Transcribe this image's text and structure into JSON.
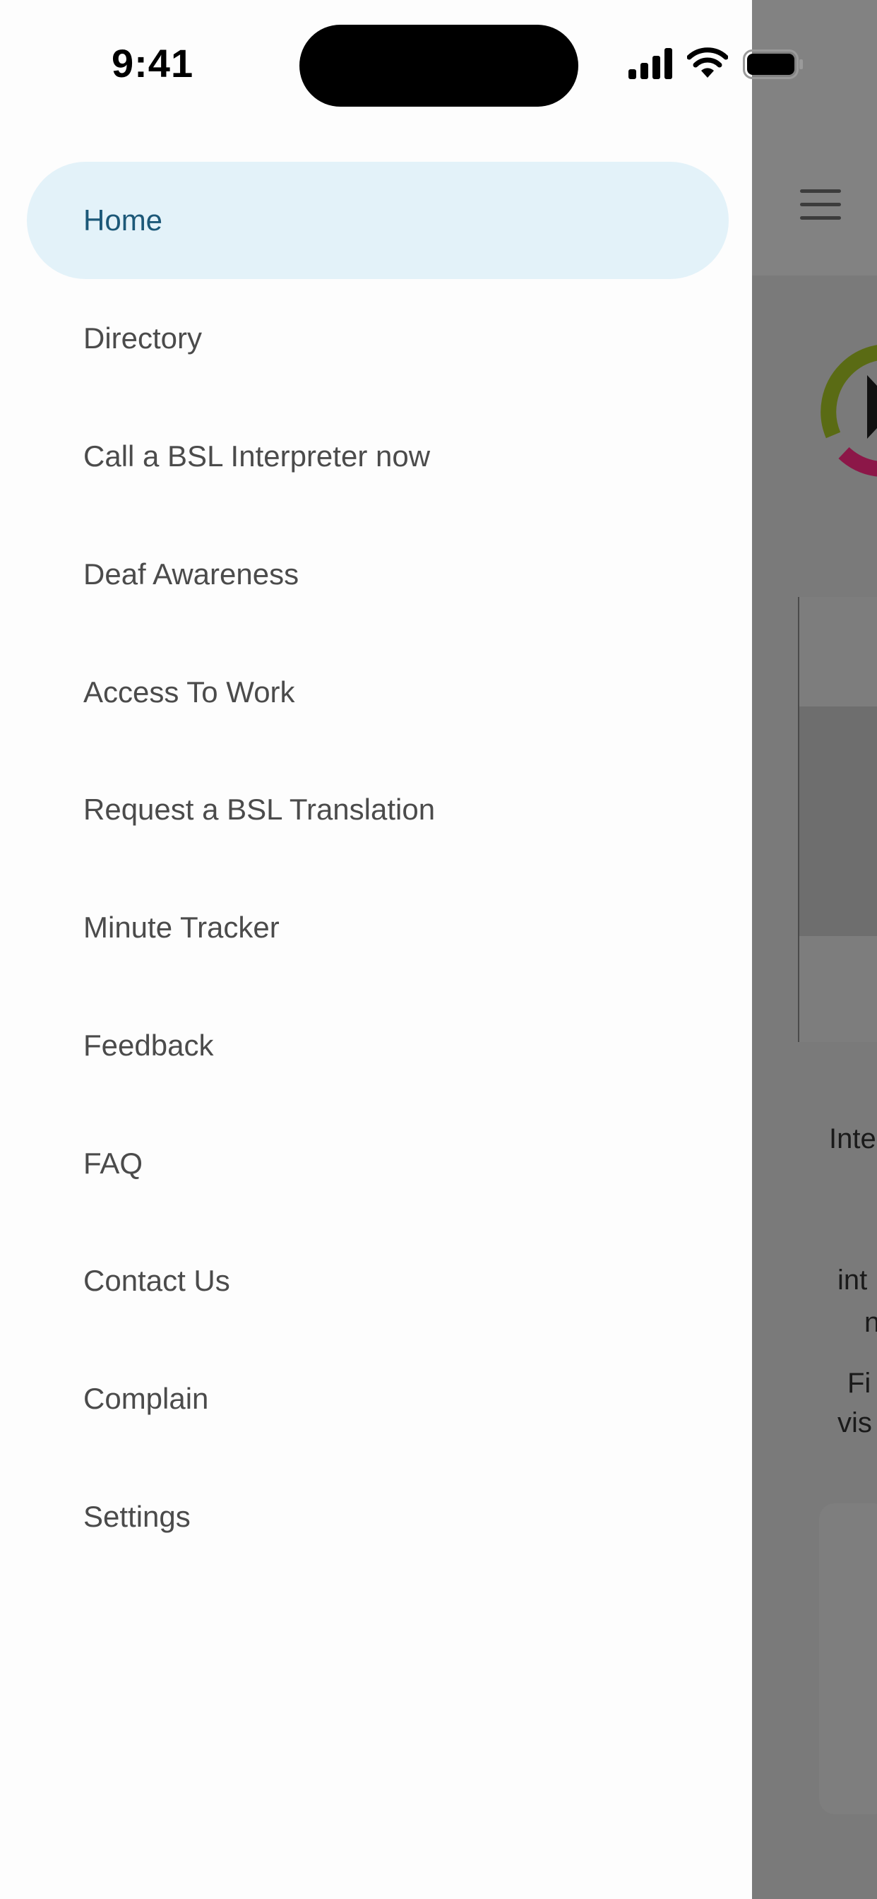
{
  "status_bar": {
    "time": "9:41",
    "icons": [
      "signal-icon",
      "wifi-icon",
      "battery-icon"
    ]
  },
  "drawer": {
    "items": [
      {
        "label": "Home",
        "active": true
      },
      {
        "label": "Directory"
      },
      {
        "label": "Call a BSL Interpreter now"
      },
      {
        "label": "Deaf Awareness"
      },
      {
        "label": "Access To Work"
      },
      {
        "label": "Request a BSL Translation"
      },
      {
        "label": "Minute Tracker"
      },
      {
        "label": "Feedback"
      },
      {
        "label": "FAQ"
      },
      {
        "label": "Contact Us"
      },
      {
        "label": "Complain"
      },
      {
        "label": "Settings"
      }
    ]
  },
  "background": {
    "menu_icon": "hamburger-icon",
    "text_fragments": [
      "Inte",
      "int",
      "n",
      "Fi",
      "vis"
    ]
  },
  "colors": {
    "active_bg": "#e3f2f9",
    "active_text": "#1c5878",
    "item_text": "#4b4b4b",
    "logo_green": "#5a6b14",
    "logo_magenta": "#8c1748"
  }
}
